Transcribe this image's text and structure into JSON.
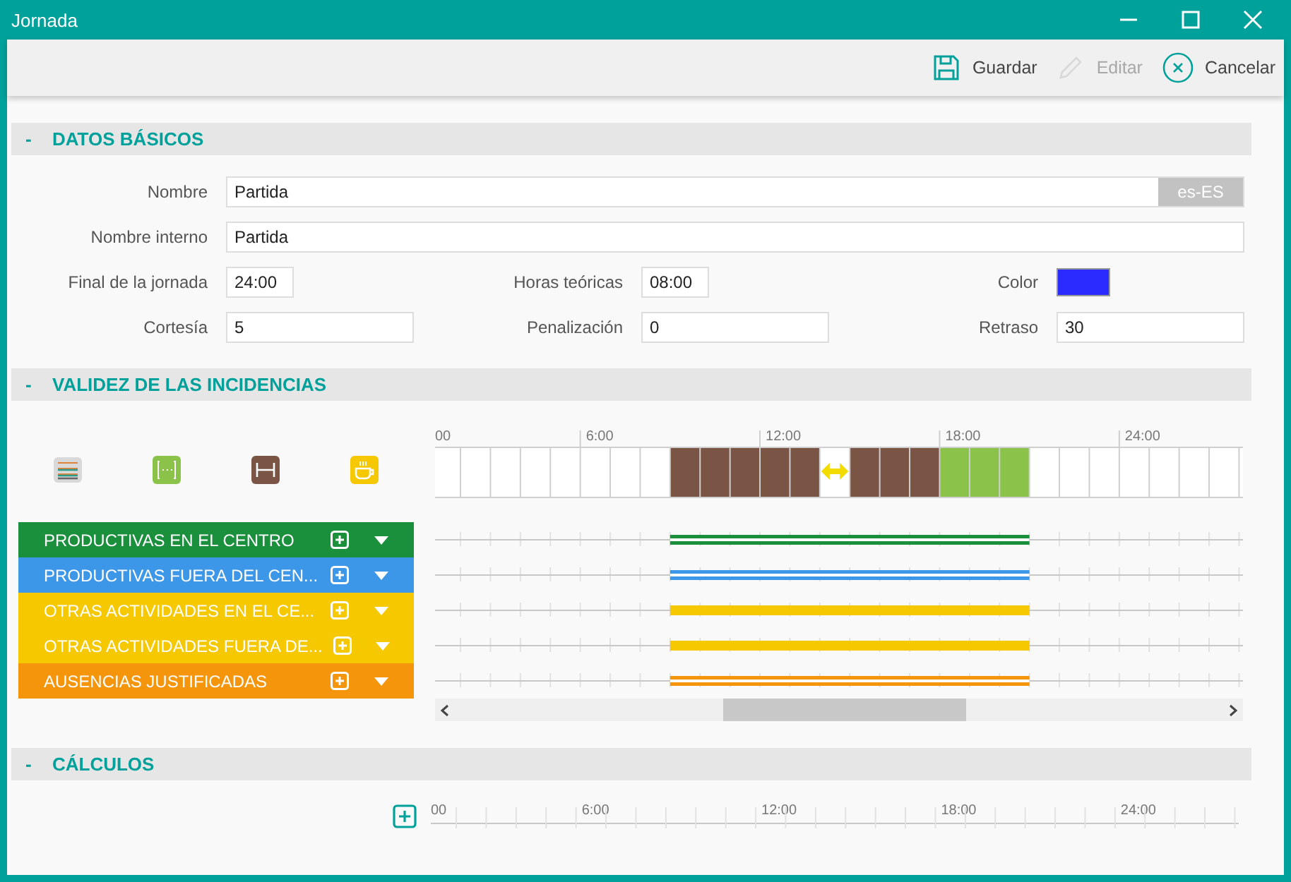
{
  "window": {
    "title": "Jornada"
  },
  "toolbar": [
    {
      "kind": "save",
      "label": "Guardar",
      "disabled": false
    },
    {
      "kind": "edit",
      "label": "Editar",
      "disabled": true
    },
    {
      "kind": "cancel",
      "label": "Cancelar",
      "disabled": false
    }
  ],
  "basic_data": {
    "toggle": "-",
    "title": "DATOS BÁSICOS",
    "name_fields": [
      {
        "label": "Nombre",
        "value": "Partida",
        "locale": "es-ES"
      },
      {
        "label": "Nombre interno",
        "value": "Partida"
      }
    ],
    "fields": [
      {
        "kind": "short",
        "label": "Final de la jornada",
        "value": "24:00"
      },
      {
        "kind": "short",
        "label": "Horas teóricas",
        "value": "08:00"
      },
      {
        "kind": "color",
        "label": "Color",
        "color": "#2b2bff"
      },
      {
        "kind": "wide",
        "label": "Cortesía",
        "value": "5"
      },
      {
        "kind": "wide",
        "label": "Penalización",
        "value": "0"
      },
      {
        "kind": "wide",
        "label": "Retraso",
        "value": "30"
      }
    ]
  },
  "incidences": {
    "toggle": "-",
    "title": "VALIDEZ DE LAS INCIDENCIAS",
    "hour_labels": [
      "00",
      "6:00",
      "12:00",
      "18:00",
      "24:00"
    ],
    "schedule_cells": [
      {
        "kind": "empty"
      },
      {
        "kind": "empty"
      },
      {
        "kind": "empty"
      },
      {
        "kind": "empty"
      },
      {
        "kind": "empty"
      },
      {
        "kind": "empty"
      },
      {
        "kind": "empty"
      },
      {
        "kind": "empty"
      },
      {
        "kind": "work"
      },
      {
        "kind": "work"
      },
      {
        "kind": "work"
      },
      {
        "kind": "work"
      },
      {
        "kind": "work"
      },
      {
        "kind": "break"
      },
      {
        "kind": "work"
      },
      {
        "kind": "work"
      },
      {
        "kind": "work"
      },
      {
        "kind": "flex"
      },
      {
        "kind": "flex"
      },
      {
        "kind": "flex"
      },
      {
        "kind": "empty"
      },
      {
        "kind": "empty"
      },
      {
        "kind": "empty"
      },
      {
        "kind": "empty"
      },
      {
        "kind": "empty"
      },
      {
        "kind": "empty"
      },
      {
        "kind": "empty"
      },
      {
        "kind": "empty"
      }
    ],
    "categories": [
      {
        "name": "PRODUCTIVAS EN EL CENTRO",
        "color": "#1a8f3c",
        "kind": "double"
      },
      {
        "name": "PRODUCTIVAS FUERA DEL CEN...",
        "color": "#3d97e8",
        "kind": "double"
      },
      {
        "name": "OTRAS ACTIVIDADES EN EL CE...",
        "color": "#f5c800",
        "kind": "solid"
      },
      {
        "name": "OTRAS ACTIVIDADES FUERA DE...",
        "color": "#f5c800",
        "kind": "solid"
      },
      {
        "name": "AUSENCIAS JUSTIFICADAS",
        "color": "#f5950c",
        "kind": "double"
      }
    ]
  },
  "calculations": {
    "toggle": "-",
    "title": "CÁLCULOS",
    "hour_labels": [
      "00",
      "6:00",
      "12:00",
      "18:00",
      "24:00"
    ]
  }
}
